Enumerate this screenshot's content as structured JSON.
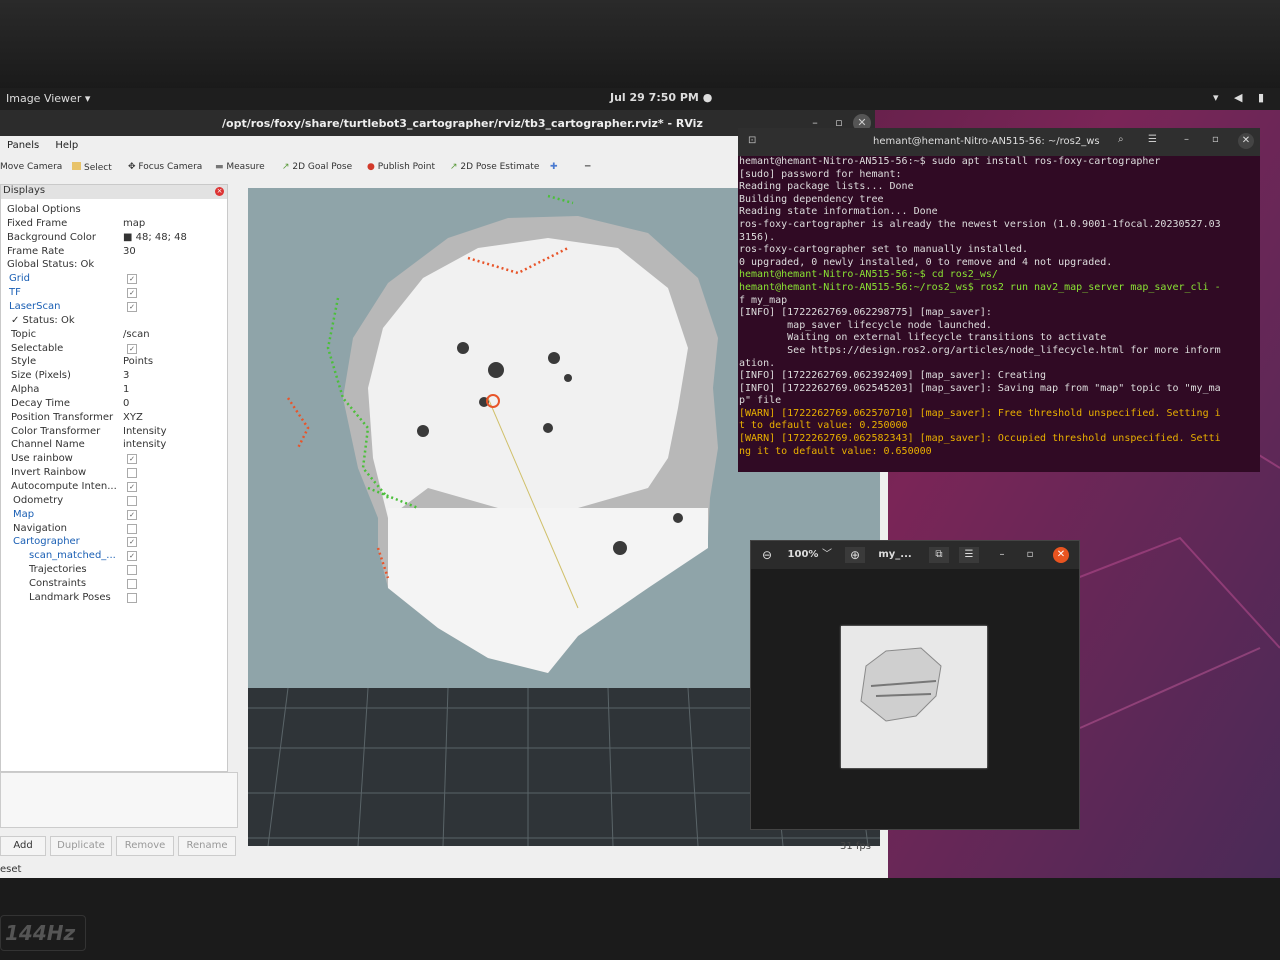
{
  "topbar": {
    "app": "Image Viewer ▾",
    "clock": "Jul 29  7:50 PM  ●",
    "sys": "▾ ◀ ▮"
  },
  "rviz": {
    "title": "/opt/ros/foxy/share/turtlebot3_cartographer/rviz/tb3_cartographer.rviz* - RViz",
    "menu": [
      "Panels",
      "Help"
    ],
    "tools": [
      "Move Camera",
      "Select",
      "Focus Camera",
      "Measure",
      "2D Goal Pose",
      "Publish Point",
      "2D Pose Estimate"
    ],
    "displays_title": "Displays",
    "rows": [
      {
        "k": "Global Options",
        "v": "",
        "indent": 6
      },
      {
        "k": "Fixed Frame",
        "v": "map",
        "indent": 6
      },
      {
        "k": "Background Color",
        "v": "■ 48; 48; 48",
        "indent": 6
      },
      {
        "k": "Frame Rate",
        "v": "30",
        "indent": 6
      },
      {
        "k": "Global Status: Ok",
        "v": "",
        "indent": 6
      },
      {
        "k": "Grid",
        "v": "✓",
        "indent": 8,
        "blue": true,
        "chk": true
      },
      {
        "k": "TF",
        "v": "✓",
        "indent": 8,
        "blue": true,
        "chk": true
      },
      {
        "k": "LaserScan",
        "v": "✓",
        "indent": 8,
        "blue": true,
        "chk": true
      },
      {
        "k": "✓  Status: Ok",
        "v": "",
        "indent": 10
      },
      {
        "k": "Topic",
        "v": "/scan",
        "indent": 10
      },
      {
        "k": "Selectable",
        "v": "✓",
        "indent": 10,
        "chk": true
      },
      {
        "k": "Style",
        "v": "Points",
        "indent": 10
      },
      {
        "k": "Size (Pixels)",
        "v": "3",
        "indent": 10
      },
      {
        "k": "Alpha",
        "v": "1",
        "indent": 10
      },
      {
        "k": "Decay Time",
        "v": "0",
        "indent": 10
      },
      {
        "k": "Position Transformer",
        "v": "XYZ",
        "indent": 10
      },
      {
        "k": "Color Transformer",
        "v": "Intensity",
        "indent": 10
      },
      {
        "k": "Channel Name",
        "v": "intensity",
        "indent": 10
      },
      {
        "k": "Use rainbow",
        "v": "✓",
        "indent": 10,
        "chk": true
      },
      {
        "k": "Invert Rainbow",
        "v": "",
        "indent": 10,
        "chk": true
      },
      {
        "k": "Autocompute Inten...",
        "v": "✓",
        "indent": 10,
        "chk": true
      },
      {
        "k": "Odometry",
        "v": "",
        "indent": 12,
        "chk": true
      },
      {
        "k": "Map",
        "v": "✓",
        "indent": 12,
        "blue": true,
        "chk": true
      },
      {
        "k": "Navigation",
        "v": "",
        "indent": 12,
        "chk": true
      },
      {
        "k": "Cartographer",
        "v": "✓",
        "indent": 12,
        "blue": true,
        "chk": true
      },
      {
        "k": "scan_matched_...",
        "v": "✓",
        "indent": 28,
        "blue": true,
        "chk": true
      },
      {
        "k": "Trajectories",
        "v": "",
        "indent": 28,
        "chk": true
      },
      {
        "k": "Constraints",
        "v": "",
        "indent": 28,
        "chk": true
      },
      {
        "k": "Landmark Poses",
        "v": "",
        "indent": 28,
        "chk": true
      }
    ],
    "buttons": [
      "Add",
      "Duplicate",
      "Remove",
      "Rename"
    ],
    "reset": "eset",
    "fps": "31 fps"
  },
  "terminal": {
    "title": "hemant@hemant-Nitro-AN515-56: ~/ros2_ws",
    "lines": [
      {
        "c": "",
        "t": "hemant@hemant-Nitro-AN515-56:~$ sudo apt install ros-foxy-cartographer"
      },
      {
        "c": "",
        "t": "[sudo] password for hemant:"
      },
      {
        "c": "",
        "t": "Reading package lists... Done"
      },
      {
        "c": "",
        "t": "Building dependency tree"
      },
      {
        "c": "",
        "t": "Reading state information... Done"
      },
      {
        "c": "",
        "t": "ros-foxy-cartographer is already the newest version (1.0.9001-1focal.20230527.03"
      },
      {
        "c": "",
        "t": "3156)."
      },
      {
        "c": "",
        "t": "ros-foxy-cartographer set to manually installed."
      },
      {
        "c": "",
        "t": "0 upgraded, 0 newly installed, 0 to remove and 4 not upgraded."
      },
      {
        "c": "g",
        "t": "hemant@hemant-Nitro-AN515-56:~$ cd ros2_ws/"
      },
      {
        "c": "g",
        "t": "hemant@hemant-Nitro-AN515-56:~/ros2_ws$ ros2 run nav2_map_server map_saver_cli -"
      },
      {
        "c": "",
        "t": "f my_map"
      },
      {
        "c": "",
        "t": "[INFO] [1722262769.062298775] [map_saver]:"
      },
      {
        "c": "",
        "t": "        map_saver lifecycle node launched."
      },
      {
        "c": "",
        "t": "        Waiting on external lifecycle transitions to activate"
      },
      {
        "c": "",
        "t": "        See https://design.ros2.org/articles/node_lifecycle.html for more inform"
      },
      {
        "c": "",
        "t": "ation."
      },
      {
        "c": "",
        "t": "[INFO] [1722262769.062392409] [map_saver]: Creating"
      },
      {
        "c": "",
        "t": "[INFO] [1722262769.062545203] [map_saver]: Saving map from \"map\" topic to \"my_ma"
      },
      {
        "c": "",
        "t": "p\" file"
      },
      {
        "c": "y",
        "t": "[WARN] [1722262769.062570710] [map_saver]: Free threshold unspecified. Setting i"
      },
      {
        "c": "y",
        "t": "t to default value: 0.250000"
      },
      {
        "c": "y",
        "t": "[WARN] [1722262769.062582343] [map_saver]: Occupied threshold unspecified. Setti"
      },
      {
        "c": "y",
        "t": "ng it to default value: 0.650000"
      }
    ]
  },
  "imageviewer": {
    "zoom": "100%",
    "filename": "my_..."
  }
}
